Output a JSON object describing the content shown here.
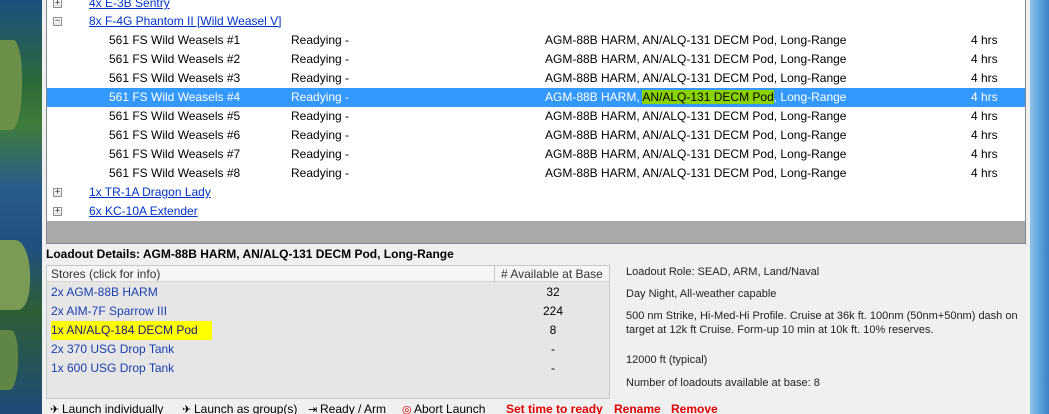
{
  "tree": {
    "groups_top": [
      {
        "label": "4x E-3B Sentry",
        "expander": "+"
      },
      {
        "label": "8x F-4G Phantom II [Wild Weasel V]",
        "expander": "−"
      }
    ],
    "aircraft": [
      {
        "name": "561 FS Wild Weasels  #1",
        "status": "Readying  -",
        "loadout_pre": "AGM-88B HARM, ",
        "loadout_pod": "AN/ALQ-131 DECM Pod",
        "loadout_post": ", Long-Range",
        "time": "4 hrs"
      },
      {
        "name": "561 FS Wild Weasels  #2",
        "status": "Readying  -",
        "loadout_pre": "AGM-88B HARM, ",
        "loadout_pod": "AN/ALQ-131 DECM Pod",
        "loadout_post": ", Long-Range",
        "time": "4 hrs"
      },
      {
        "name": "561 FS Wild Weasels  #3",
        "status": "Readying  -",
        "loadout_pre": "AGM-88B HARM, ",
        "loadout_pod": "AN/ALQ-131 DECM Pod",
        "loadout_post": ", Long-Range",
        "time": "4 hrs"
      },
      {
        "name": "561 FS Wild Weasels  #4",
        "status": "Readying  -",
        "loadout_pre": "AGM-88B HARM, ",
        "loadout_pod": "AN/ALQ-131 DECM Pod",
        "loadout_post": ", Long-Range",
        "time": "4 hrs"
      },
      {
        "name": "561 FS Wild Weasels  #5",
        "status": "Readying  -",
        "loadout_pre": "AGM-88B HARM, ",
        "loadout_pod": "AN/ALQ-131 DECM Pod",
        "loadout_post": ", Long-Range",
        "time": "4 hrs"
      },
      {
        "name": "561 FS Wild Weasels  #6",
        "status": "Readying  -",
        "loadout_pre": "AGM-88B HARM, ",
        "loadout_pod": "AN/ALQ-131 DECM Pod",
        "loadout_post": ", Long-Range",
        "time": "4 hrs"
      },
      {
        "name": "561 FS Wild Weasels  #7",
        "status": "Readying  -",
        "loadout_pre": "AGM-88B HARM, ",
        "loadout_pod": "AN/ALQ-131 DECM Pod",
        "loadout_post": ", Long-Range",
        "time": "4 hrs"
      },
      {
        "name": "561 FS Wild Weasels  #8",
        "status": "Readying  -",
        "loadout_pre": "AGM-88B HARM, ",
        "loadout_pod": "AN/ALQ-131 DECM Pod",
        "loadout_post": ", Long-Range",
        "time": "4 hrs"
      }
    ],
    "selected_index": 3,
    "groups_bottom": [
      {
        "label": "1x TR-1A Dragon Lady",
        "expander": "+"
      },
      {
        "label": "6x KC-10A Extender",
        "expander": "+"
      }
    ]
  },
  "details": {
    "title": "Loadout Details: AGM-88B HARM, AN/ALQ-131 DECM Pod, Long-Range",
    "stores_header": "Stores (click for info)",
    "available_header": "# Available at Base",
    "stores": [
      {
        "name": "2x AGM-88B HARM",
        "available": "32"
      },
      {
        "name": "2x AIM-7F Sparrow III",
        "available": "224"
      },
      {
        "name": "1x AN/ALQ-184 DECM Pod",
        "available": "8"
      },
      {
        "name": "2x 370 USG Drop Tank",
        "available": "-"
      },
      {
        "name": "1x 600 USG Drop Tank",
        "available": "-"
      }
    ],
    "highlighted_store_index": 2,
    "info": {
      "role": "Loadout Role: SEAD, ARM, Land/Naval",
      "capability": "Day  Night, All-weather capable",
      "profile": "500 nm Strike, Hi-Med-Hi Profile. Cruise at 36k ft. 100nm (50nm+50nm) dash on target at 12k ft  Cruise. Form-up 10 min at 10k ft. 10% reserves.",
      "altitude": "12000 ft (typical)",
      "count": "Number of loadouts available at base: 8"
    }
  },
  "toolbar": {
    "launch_individually": "Launch individually",
    "launch_group": "Launch as group(s)",
    "ready_arm": "Ready / Arm",
    "abort_launch": "Abort Launch",
    "set_time": "Set time to ready",
    "rename": "Rename",
    "remove": "Remove"
  },
  "colors": {
    "selection": "#3399ff",
    "highlight": "#ffff00",
    "link": "#0033cc",
    "action_red": "#e00000"
  }
}
